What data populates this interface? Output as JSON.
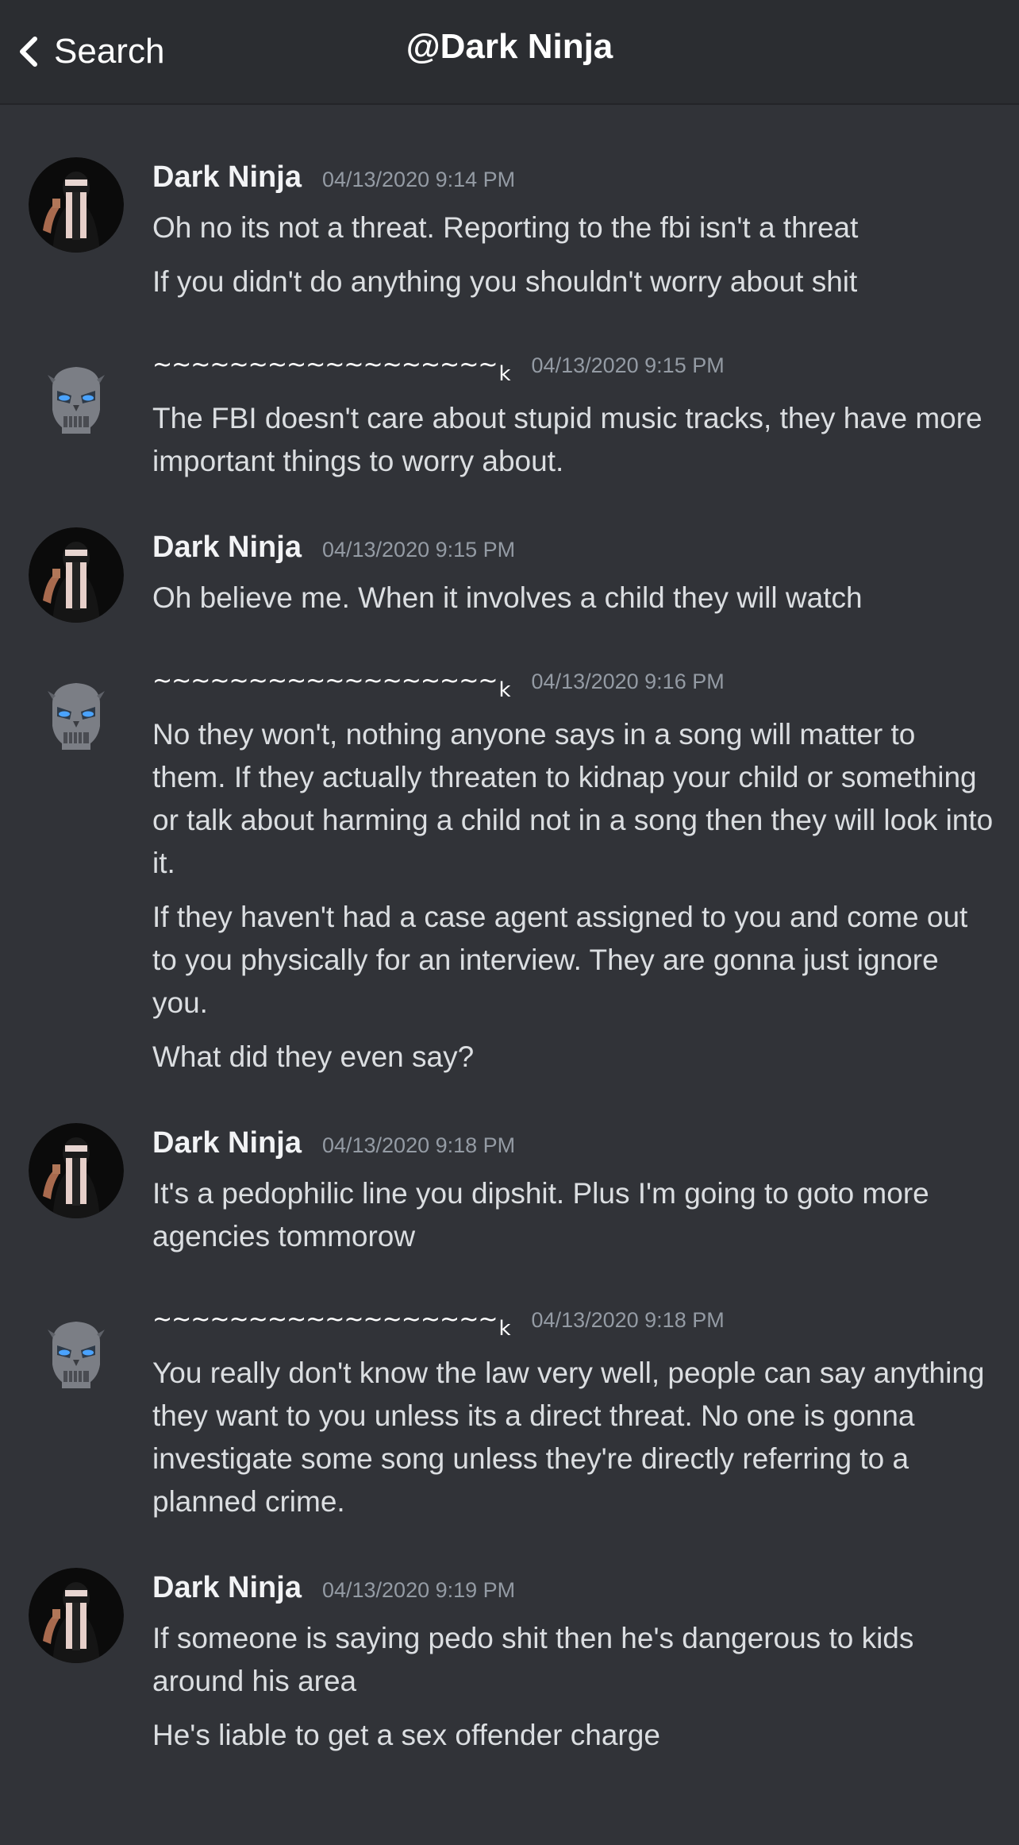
{
  "header": {
    "back_label": "Search",
    "title": "@Dark Ninja"
  },
  "messages": [
    {
      "author": "Dark Ninja",
      "author_type": "ninja",
      "timestamp": "04/13/2020 9:14 PM",
      "lines": [
        "Oh no its not a threat. Reporting to the fbi isn't a threat",
        "If you didn't do anything you shouldn't worry about shit"
      ]
    },
    {
      "author": "~~~~~~~~~~~~~~~~~~",
      "author_suffix": "k",
      "author_type": "bot",
      "timestamp": "04/13/2020 9:15 PM",
      "lines": [
        "The FBI doesn't care about stupid music tracks, they have more important things to worry about."
      ]
    },
    {
      "author": "Dark Ninja",
      "author_type": "ninja",
      "timestamp": "04/13/2020 9:15 PM",
      "lines": [
        "Oh believe me. When it involves a child they will watch"
      ]
    },
    {
      "author": "~~~~~~~~~~~~~~~~~~",
      "author_suffix": "k",
      "author_type": "bot",
      "timestamp": "04/13/2020 9:16 PM",
      "lines": [
        "No they won't, nothing anyone says in a song will matter to them. If they actually threaten to kidnap your child or something or talk about harming a child not in a song then they will look into it.",
        "If they haven't had a case agent assigned to you and come out to you physically for an interview. They are gonna just ignore you.",
        "What did they even say?"
      ]
    },
    {
      "author": "Dark Ninja",
      "author_type": "ninja",
      "timestamp": "04/13/2020 9:18 PM",
      "lines": [
        "It's a pedophilic line you dipshit. Plus I'm going to goto more agencies tommorow"
      ]
    },
    {
      "author": "~~~~~~~~~~~~~~~~~~",
      "author_suffix": "k",
      "author_type": "bot",
      "timestamp": "04/13/2020 9:18 PM",
      "lines": [
        "You really don't know the law very well, people can say anything they want to you unless its a direct threat. No one is gonna investigate some song unless they're directly referring to a planned crime."
      ]
    },
    {
      "author": "Dark Ninja",
      "author_type": "ninja",
      "timestamp": "04/13/2020 9:19 PM",
      "lines": [
        "If someone is saying pedo shit then he's dangerous to kids around his area",
        "He's liable to get a sex offender charge"
      ]
    }
  ],
  "colors": {
    "background": "#313338",
    "header_background": "#2b2d31",
    "text": "#dbdee1",
    "timestamp": "#949ba4",
    "author": "#f2f3f5"
  },
  "icons": {
    "back": "chevron-left-icon",
    "ninja_avatar": "ninja-avatar",
    "bot_avatar": "robot-skull-avatar"
  }
}
